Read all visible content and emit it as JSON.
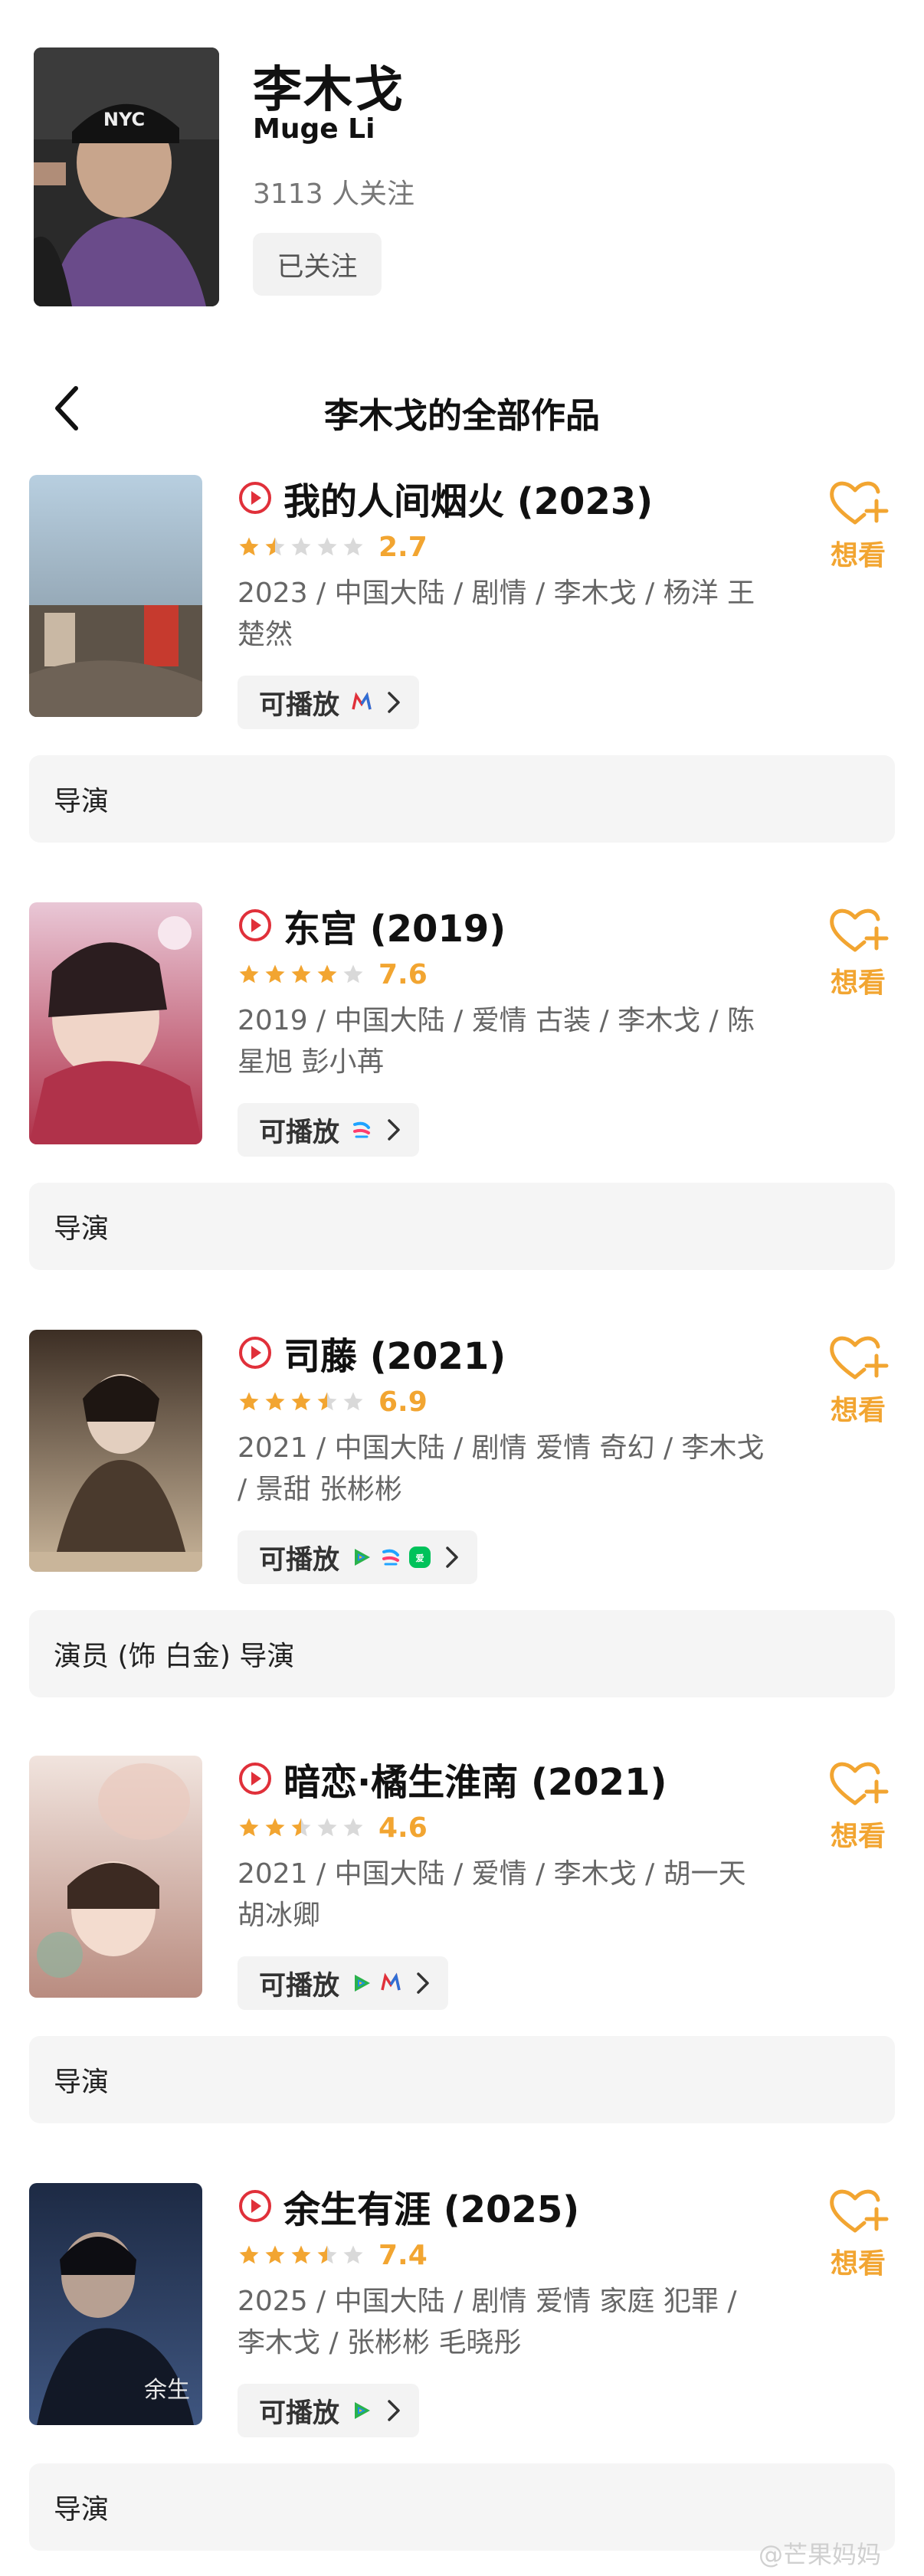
{
  "profile": {
    "name": "李木戈",
    "name_en": "Muge Li",
    "followers": "3113 人关注",
    "follow_button": "已关注"
  },
  "nav": {
    "title": "李木戈的全部作品"
  },
  "films": [
    {
      "title": "我的人间烟火 (2023)",
      "rating": 2.7,
      "score": "2.7",
      "meta": "2023 / 中国大陆 / 剧情 / 李木戈 / 杨洋 王楚然",
      "playable": "可播放",
      "platforms": [
        "mango-tv-icon"
      ],
      "want": "想看",
      "role": "导演",
      "poster_colors": [
        "#b8cfe0",
        "#7a8a96",
        "#5d5348"
      ]
    },
    {
      "title": "东宫 (2019)",
      "rating": 7.6,
      "score": "7.6",
      "meta": "2019 / 中国大陆 / 爱情 古装 / 李木戈 / 陈星旭 彭小苒",
      "playable": "可播放",
      "platforms": [
        "youku-icon"
      ],
      "want": "想看",
      "role": "导演",
      "poster_colors": [
        "#e9c7d6",
        "#b0324a",
        "#f2e2ea"
      ]
    },
    {
      "title": "司藤 (2021)",
      "rating": 6.9,
      "score": "6.9",
      "meta": "2021 / 中国大陆 / 剧情 爱情 奇幻 / 李木戈 / 景甜 张彬彬",
      "playable": "可播放",
      "platforms": [
        "tencent-video-icon",
        "youku-icon",
        "iqiyi-icon"
      ],
      "want": "想看",
      "role": "演员 (饰 白金) 导演",
      "poster_colors": [
        "#3c2e24",
        "#c9b59a",
        "#6d4f3a"
      ]
    },
    {
      "title": "暗恋·橘生淮南 (2021)",
      "rating": 4.6,
      "score": "4.6",
      "meta": "2021 / 中国大陆 / 爱情 / 李木戈 / 胡一天 胡冰卿",
      "playable": "可播放",
      "platforms": [
        "tencent-video-icon",
        "mango-tv-icon"
      ],
      "want": "想看",
      "role": "导演",
      "poster_colors": [
        "#f1e4de",
        "#b98c80",
        "#8fb29c"
      ]
    },
    {
      "title": "余生有涯 (2025)",
      "rating": 7.4,
      "score": "7.4",
      "meta": "2025 / 中国大陆 / 剧情 爱情 家庭 犯罪 / 李木戈 / 张彬彬 毛晓彤",
      "playable": "可播放",
      "platforms": [
        "tencent-video-icon"
      ],
      "want": "想看",
      "role": "导演",
      "poster_colors": [
        "#1d2a44",
        "#3f5680",
        "#0f1522"
      ]
    }
  ],
  "watermark": "@芒果妈妈",
  "colors": {
    "accent_orange": "#f2a531",
    "play_red": "#e0303a",
    "star_empty": "#d9d9d9"
  }
}
